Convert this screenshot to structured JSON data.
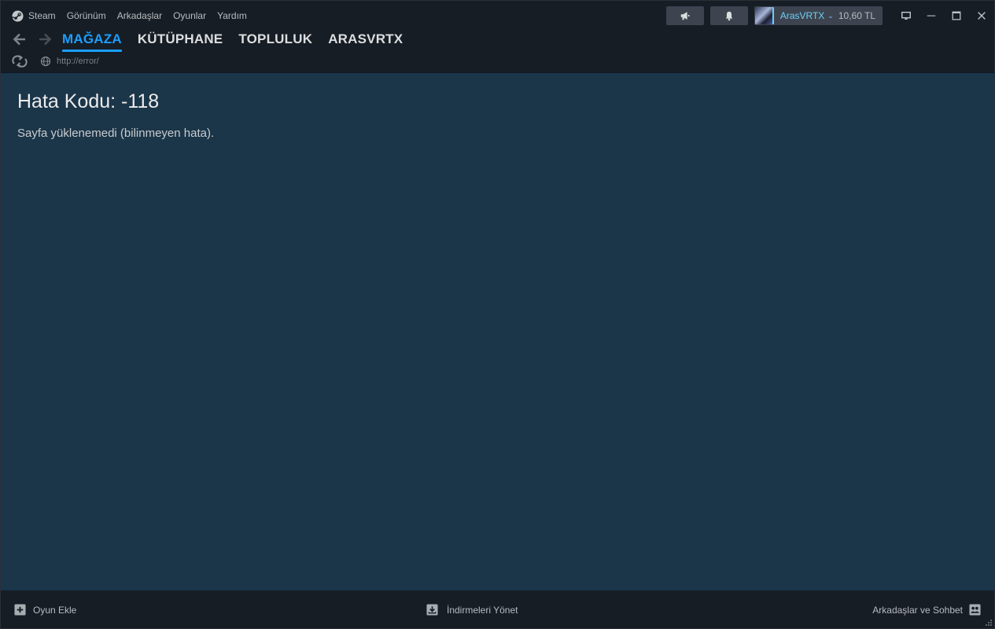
{
  "menu": {
    "steam": "Steam",
    "view": "Görünüm",
    "friends": "Arkadaşlar",
    "games": "Oyunlar",
    "help": "Yardım"
  },
  "account": {
    "name": "ArasVRTX",
    "balance": "10,60 TL"
  },
  "nav": {
    "tabs": [
      {
        "label": "MAĞAZA",
        "active": true
      },
      {
        "label": "KÜTÜPHANE",
        "active": false
      },
      {
        "label": "TOPLULUK",
        "active": false
      },
      {
        "label": "ARASVRTX",
        "active": false
      }
    ]
  },
  "url": "http://error/",
  "error": {
    "title": "Hata Kodu: -118",
    "message": "Sayfa yüklenemedi (bilinmeyen hata)."
  },
  "bottom": {
    "add_game": "Oyun Ekle",
    "manage_downloads": "İndirmeleri Yönet",
    "friends_chat": "Arkadaşlar ve Sohbet"
  },
  "colors": {
    "accent": "#1a9fff",
    "account_name": "#6dcff6",
    "content_bg": "#1b3549",
    "chrome_bg": "#171d25"
  }
}
